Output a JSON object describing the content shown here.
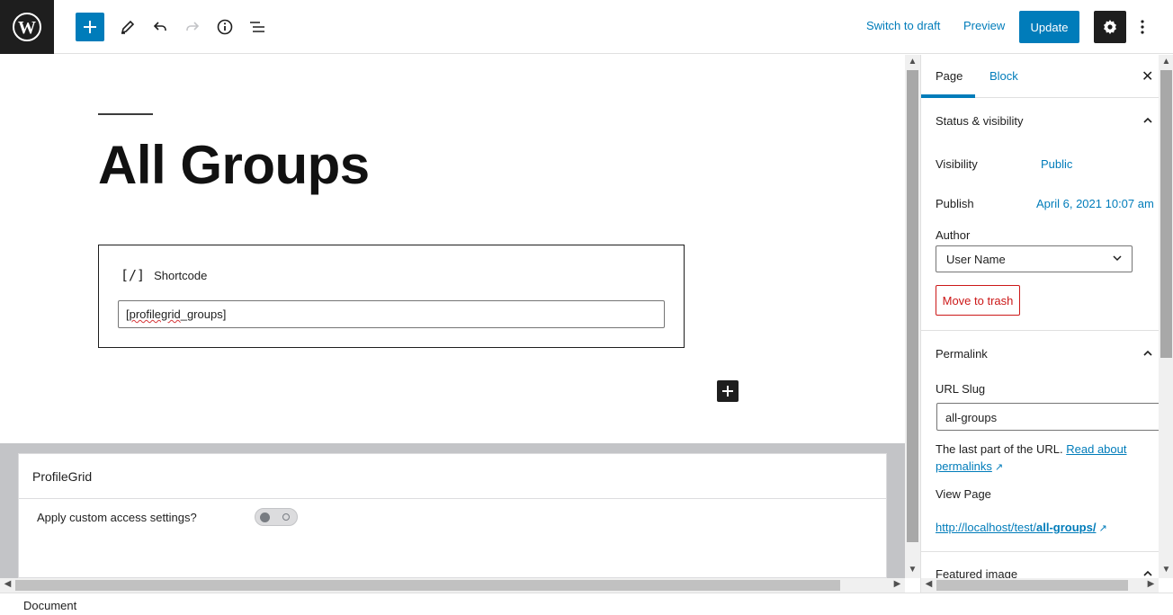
{
  "toolbar": {
    "switch_to_draft": "Switch to draft",
    "preview": "Preview",
    "update": "Update"
  },
  "editor": {
    "title": "All Groups",
    "shortcode_label": "Shortcode",
    "shortcode_icon": "[/]",
    "shortcode_value_part1": "[",
    "shortcode_value_misspelled": "profilegrid",
    "shortcode_value_part2": "_groups]"
  },
  "metabox": {
    "title": "ProfileGrid",
    "custom_access_label": "Apply custom access settings?",
    "custom_access_enabled": false
  },
  "sidebar": {
    "tabs": [
      "Page",
      "Block"
    ],
    "active_tab": "Page",
    "status_panel": "Status & visibility",
    "visibility_label": "Visibility",
    "visibility_value": "Public",
    "publish_label": "Publish",
    "publish_value": "April 6, 2021 10:07 am",
    "author_label": "Author",
    "author_value": "User Name",
    "trash": "Move to trash",
    "permalink_panel": "Permalink",
    "slug_label": "URL Slug",
    "slug_value": "all-groups",
    "help_text": "The last part of the URL.",
    "help_link": "Read about permalinks",
    "view_page_label": "View Page",
    "view_link_base": "http://localhost/test/",
    "view_link_slug": "all-groups/",
    "featured_panel": "Featured image"
  },
  "footer": {
    "breadcrumb": "Document"
  },
  "colors": {
    "accent": "#007cba",
    "dark": "#1e1e1e",
    "danger": "#cc1818"
  }
}
